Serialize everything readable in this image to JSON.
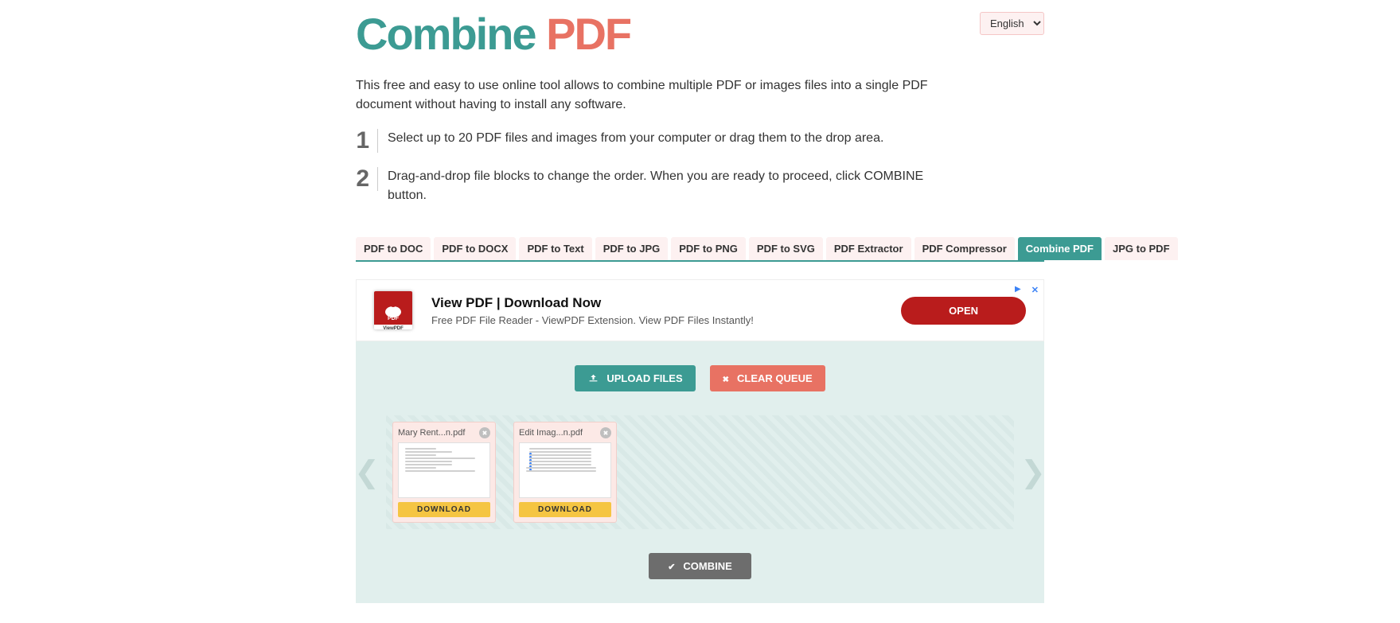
{
  "logo": {
    "part1": "Combine ",
    "part2": "PDF"
  },
  "language": {
    "selected": "English"
  },
  "description": "This free and easy to use online tool allows to combine multiple PDF or images files into a single PDF document without having to install any software.",
  "steps": [
    {
      "num": "1",
      "text": "Select up to 20 PDF files and images from your computer or drag them to the drop area."
    },
    {
      "num": "2",
      "text": "Drag-and-drop file blocks to change the order. When you are ready to proceed, click COMBINE button."
    }
  ],
  "tabs": [
    {
      "label": "PDF to DOC",
      "active": false
    },
    {
      "label": "PDF to DOCX",
      "active": false
    },
    {
      "label": "PDF to Text",
      "active": false
    },
    {
      "label": "PDF to JPG",
      "active": false
    },
    {
      "label": "PDF to PNG",
      "active": false
    },
    {
      "label": "PDF to SVG",
      "active": false
    },
    {
      "label": "PDF Extractor",
      "active": false
    },
    {
      "label": "PDF Compressor",
      "active": false
    },
    {
      "label": "Combine PDF",
      "active": true
    },
    {
      "label": "JPG to PDF",
      "active": false
    }
  ],
  "ad": {
    "icon_label": "PDF",
    "icon_sub": "ViewPDF",
    "title": "View PDF | Download Now",
    "desc": "Free PDF File Reader - ViewPDF Extension. View PDF Files Instantly!",
    "cta": "OPEN",
    "close": "✕"
  },
  "buttons": {
    "upload": "UPLOAD FILES",
    "clear": "CLEAR QUEUE",
    "combine": "COMBINE"
  },
  "carousel": {
    "left": "❮",
    "right": "❯"
  },
  "files": [
    {
      "name": "Mary Rent...n.pdf",
      "download": "DOWNLOAD",
      "thumb_style": "text"
    },
    {
      "name": "Edit Imag...n.pdf",
      "download": "DOWNLOAD",
      "thumb_style": "bullets"
    }
  ]
}
